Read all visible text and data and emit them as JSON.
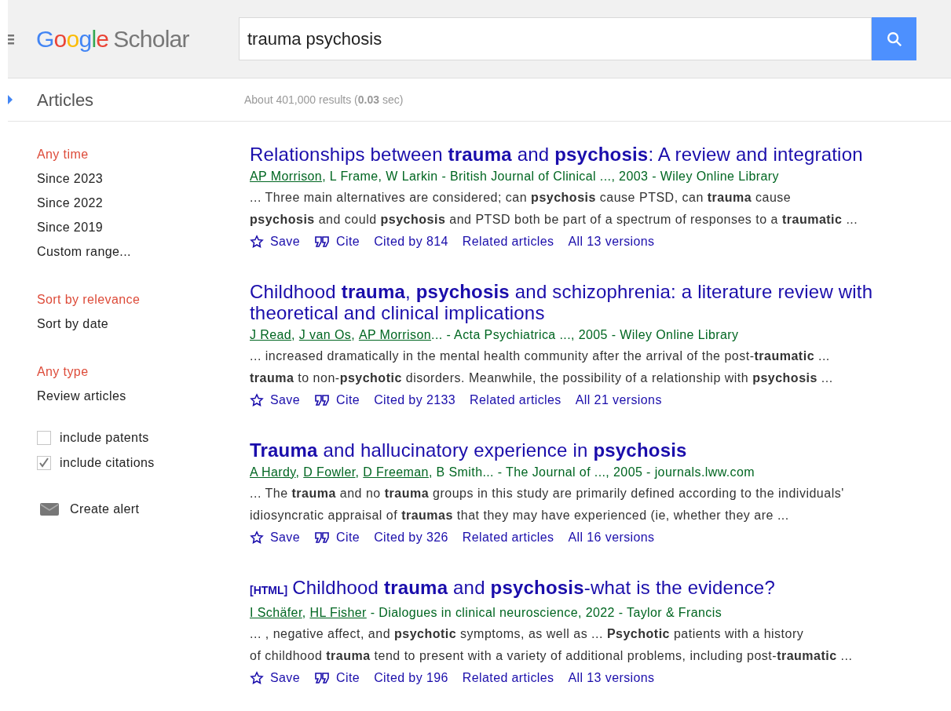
{
  "header": {
    "logo": {
      "brand": "Google",
      "product": "Scholar"
    },
    "search": {
      "value": "trauma psychosis"
    }
  },
  "subheader": {
    "section": "Articles",
    "results": "About 401,000 results (**0.03** sec)"
  },
  "sidebar": {
    "groups": [
      {
        "items": [
          {
            "label": "Any time",
            "selected": true
          },
          {
            "label": "Since 2023",
            "selected": false
          },
          {
            "label": "Since 2022",
            "selected": false
          },
          {
            "label": "Since 2019",
            "selected": false
          },
          {
            "label": "Custom range...",
            "selected": false
          }
        ]
      },
      {
        "items": [
          {
            "label": "Sort by relevance",
            "selected": true
          },
          {
            "label": "Sort by date",
            "selected": false
          }
        ]
      },
      {
        "items": [
          {
            "label": "Any type",
            "selected": true
          },
          {
            "label": "Review articles",
            "selected": false
          }
        ]
      }
    ],
    "checkboxes": [
      {
        "label": "include patents",
        "checked": false
      },
      {
        "label": "include citations",
        "checked": true
      }
    ],
    "alert": "Create alert"
  },
  "results": [
    {
      "title": "Relationships between **trauma** and **psychosis**: A review and integration",
      "byline": [
        {
          "text": "AP Morrison",
          "linked": true
        },
        {
          "text": ", L Frame, W Larkin - British Journal of Clinical ..., 2003 - Wiley Online Library",
          "linked": false
        }
      ],
      "snippet": [
        "... Three main alternatives are considered; can **psychosis** cause PTSD, can **trauma** cause",
        "**psychosis** and could **psychosis** and PTSD both be part of a spectrum of responses to a **traumatic** ..."
      ],
      "actions": [
        {
          "kind": "save",
          "label": "Save"
        },
        {
          "kind": "cite",
          "label": "Cite"
        },
        {
          "kind": "link",
          "label": "Cited by 814"
        },
        {
          "kind": "link",
          "label": "Related articles"
        },
        {
          "kind": "link",
          "label": "All 13 versions"
        }
      ]
    },
    {
      "title": "Childhood **trauma**, **psychosis** and schizophrenia: a literature review with theoretical and clinical implications",
      "byline": [
        {
          "text": "J Read",
          "linked": true,
          "trail": ","
        },
        {
          "text": "J van Os",
          "linked": true,
          "trail": ","
        },
        {
          "text": "AP Morrison",
          "linked": true
        },
        {
          "text": "... - Acta Psychiatrica ..., 2005 - Wiley Online Library",
          "linked": false
        }
      ],
      "snippet": [
        "... increased dramatically in the mental health community after the arrival of the post-**traumatic** ...",
        "**trauma** to non-**psychotic** disorders. Meanwhile, the possibility of a relationship with **psychosis** ..."
      ],
      "actions": [
        {
          "kind": "save",
          "label": "Save"
        },
        {
          "kind": "cite",
          "label": "Cite"
        },
        {
          "kind": "link",
          "label": "Cited by 2133"
        },
        {
          "kind": "link",
          "label": "Related articles"
        },
        {
          "kind": "link",
          "label": "All 21 versions"
        }
      ]
    },
    {
      "title": "**Trauma** and hallucinatory experience in **psychosis**",
      "byline": [
        {
          "text": "A Hardy",
          "linked": true,
          "trail": ","
        },
        {
          "text": "D Fowler",
          "linked": true,
          "trail": ","
        },
        {
          "text": "D Freeman",
          "linked": true
        },
        {
          "text": ", B Smith... - The Journal of ..., 2005 - journals.lww.com",
          "linked": false
        }
      ],
      "snippet": [
        "... The **trauma** and no **trauma** groups in this study are primarily defined according to the individuals'",
        "idiosyncratic appraisal of **traumas** that they may have experienced (ie, whether they are ..."
      ],
      "actions": [
        {
          "kind": "save",
          "label": "Save"
        },
        {
          "kind": "cite",
          "label": "Cite"
        },
        {
          "kind": "link",
          "label": "Cited by 326"
        },
        {
          "kind": "link",
          "label": "Related articles"
        },
        {
          "kind": "link",
          "label": "All 16 versions"
        }
      ]
    },
    {
      "tag": "[HTML]",
      "title": "Childhood **trauma** and **psychosis**-what is the evidence?",
      "byline": [
        {
          "text": "I Schäfer",
          "linked": true,
          "trail": ","
        },
        {
          "text": "HL Fisher",
          "linked": true
        },
        {
          "text": " - Dialogues in clinical neuroscience, 2022 - Taylor & Francis",
          "linked": false
        }
      ],
      "snippet": [
        "... , negative affect, and **psychotic** symptoms, as well as ... **Psychotic** patients with a history",
        "of childhood **trauma** tend to present with a variety of additional problems, including post-**traumatic** ..."
      ],
      "actions": [
        {
          "kind": "save",
          "label": "Save"
        },
        {
          "kind": "cite",
          "label": "Cite"
        },
        {
          "kind": "link",
          "label": "Cited by 196"
        },
        {
          "kind": "link",
          "label": "Related articles"
        },
        {
          "kind": "link",
          "label": "All 13 versions"
        }
      ]
    }
  ]
}
